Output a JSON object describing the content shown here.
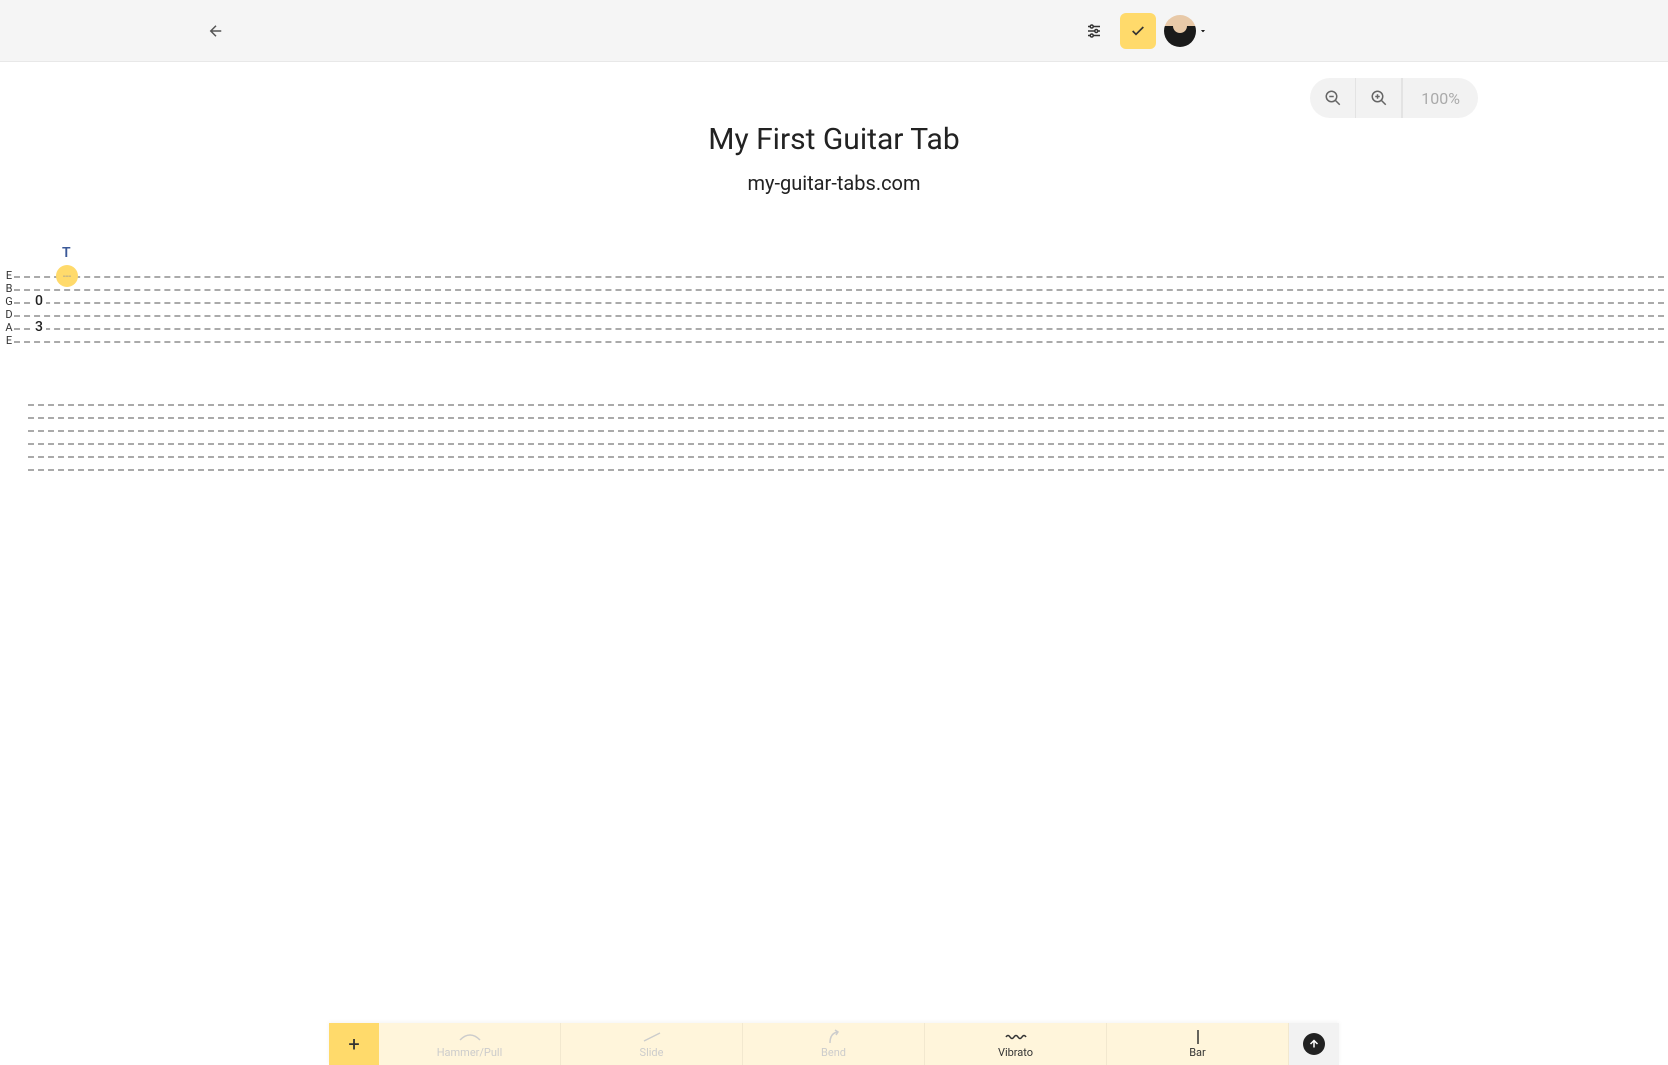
{
  "header": {
    "back_icon": "arrow-left"
  },
  "zoom": {
    "value": "100%"
  },
  "document": {
    "title": "My First Guitar Tab",
    "subtitle": "my-guitar-tabs.com",
    "tab_marker": "T"
  },
  "strings": [
    "E",
    "B",
    "G",
    "D",
    "A",
    "E"
  ],
  "tab_notes": {
    "cursor_string_index": 0,
    "cursor_display": "---",
    "notes": [
      {
        "string_index": 2,
        "position": 28,
        "fret": "0"
      },
      {
        "string_index": 4,
        "position": 28,
        "fret": "3"
      }
    ]
  },
  "toolbar": {
    "add": "+",
    "items": [
      {
        "label": "Hammer/Pull",
        "enabled": false,
        "icon": "arc"
      },
      {
        "label": "Slide",
        "enabled": false,
        "icon": "slash"
      },
      {
        "label": "Bend",
        "enabled": false,
        "icon": "curve-up"
      },
      {
        "label": "Vibrato",
        "enabled": true,
        "icon": "wave"
      },
      {
        "label": "Bar",
        "enabled": true,
        "icon": "bar"
      }
    ]
  }
}
